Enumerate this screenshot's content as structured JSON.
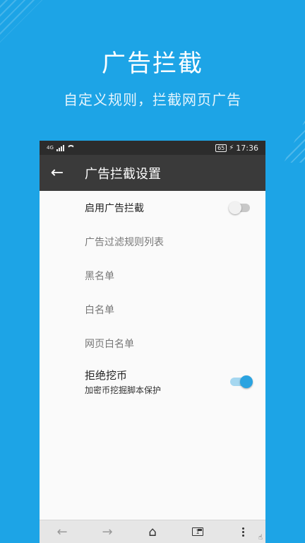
{
  "promo": {
    "headline": "广告拦截",
    "subline": "自定义规则，拦截网页广告"
  },
  "status_bar": {
    "network": "4G",
    "battery": "65",
    "time": "17:36"
  },
  "app_bar": {
    "title": "广告拦截设置"
  },
  "settings": {
    "enable_adblock": {
      "label": "启用广告拦截",
      "enabled": false
    },
    "filter_rules": {
      "label": "广告过滤规则列表"
    },
    "blacklist": {
      "label": "黑名单"
    },
    "whitelist": {
      "label": "白名单"
    },
    "page_whitelist": {
      "label": "网页白名单"
    },
    "anti_mining": {
      "title": "拒绝挖币",
      "summary": "加密币挖掘脚本保护",
      "enabled": true
    }
  },
  "bottom_bar": {
    "tab_count": "1"
  },
  "colors": {
    "background": "#1da4e6",
    "app_bar": "#3a3a3a",
    "accent": "#2aa3e0"
  }
}
